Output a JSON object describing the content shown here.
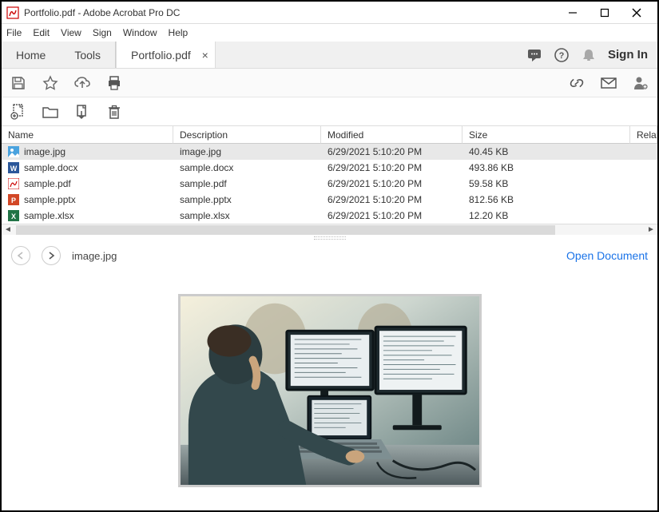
{
  "app": {
    "title": "Portfolio.pdf - Adobe Acrobat Pro DC"
  },
  "menus": [
    "File",
    "Edit",
    "View",
    "Sign",
    "Window",
    "Help"
  ],
  "tabs": {
    "home": "Home",
    "tools": "Tools",
    "doc_label": "Portfolio.pdf",
    "sign_in": "Sign In"
  },
  "columns": [
    "Name",
    "Description",
    "Modified",
    "Size",
    "Relationship"
  ],
  "rows": [
    {
      "name": "image.jpg",
      "desc": "image.jpg",
      "modified": "6/29/2021 5:10:20 PM",
      "size": "40.45 KB",
      "icon": "jpg"
    },
    {
      "name": "sample.docx",
      "desc": "sample.docx",
      "modified": "6/29/2021 5:10:20 PM",
      "size": "493.86 KB",
      "icon": "docx"
    },
    {
      "name": "sample.pdf",
      "desc": "sample.pdf",
      "modified": "6/29/2021 5:10:20 PM",
      "size": "59.58 KB",
      "icon": "pdf"
    },
    {
      "name": "sample.pptx",
      "desc": "sample.pptx",
      "modified": "6/29/2021 5:10:20 PM",
      "size": "812.56 KB",
      "icon": "pptx"
    },
    {
      "name": "sample.xlsx",
      "desc": "sample.xlsx",
      "modified": "6/29/2021 5:10:20 PM",
      "size": "12.20 KB",
      "icon": "xlsx"
    }
  ],
  "selected_index": 0,
  "preview": {
    "filename": "image.jpg",
    "open_label": "Open Document"
  }
}
